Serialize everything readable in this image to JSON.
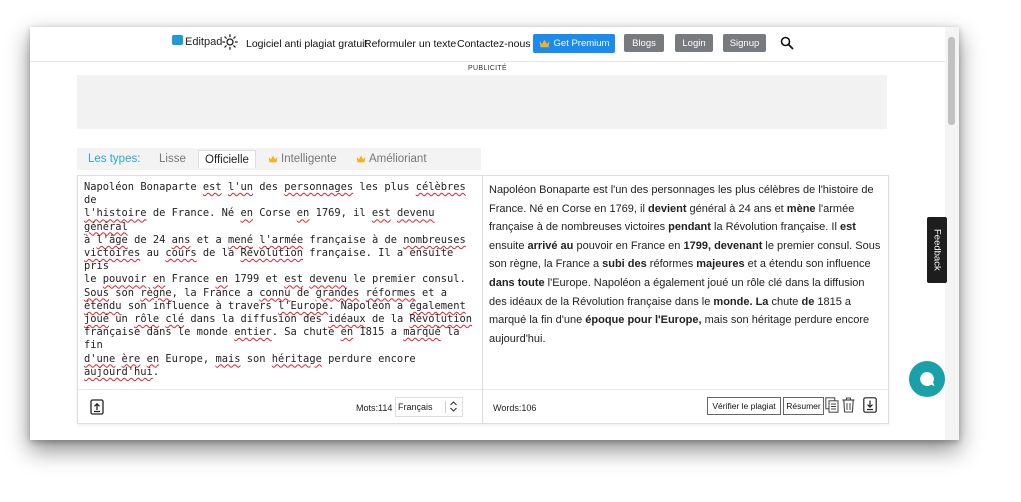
{
  "nav": {
    "brand": "Editpad",
    "links": [
      "Logiciel anti plagiat gratuit",
      "Reformuler un texte",
      "Contactez-nous"
    ],
    "premium_label": "Get Premium",
    "blogs_label": "Blogs",
    "login_label": "Login",
    "signup_label": "Signup"
  },
  "ad": {
    "label": "PUBLICITÉ"
  },
  "types": {
    "label": "Les types:",
    "lisse": "Lisse",
    "officielle": "Officielle",
    "intelligente": "Intelligente",
    "ameliorant": "Amélioriant"
  },
  "left": {
    "lines": [
      "Napoléon Bonaparte est l'un des personnages les plus célèbres de",
      "l'histoire de France. Né en Corse en 1769, il est devenu général",
      "à l'âge de 24 ans et a mené l'armée française à de nombreuses",
      "victoires au cours de la Révolution française. Il a ensuite pris",
      "le pouvoir en France en 1799 et est devenu le premier consul.",
      "Sous son règne, la France a connu de grandes réformes et a",
      "étendu son influence à travers l'Europe. Napoléon a également",
      "joué un rôle clé dans la diffusion des idéaux de la Révolution",
      "française dans le monde entier. Sa chute en 1815 a marqué la fin",
      "d'une ère en Europe, mais son héritage perdure encore",
      "aujourd'hui."
    ],
    "word_count": "Mots:114",
    "language": "Français"
  },
  "right": {
    "segments": [
      {
        "t": "Napoléon Bonaparte est l'un des personnages les plus célèbres de l'histoire de France. Né en Corse en 1769, il ",
        "b": false
      },
      {
        "t": "devient",
        "b": true
      },
      {
        "t": " général à  24 ans et ",
        "b": false
      },
      {
        "t": "mène",
        "b": true
      },
      {
        "t": " l'armée française à de nombreuses victoires ",
        "b": false
      },
      {
        "t": "pendant",
        "b": true
      },
      {
        "t": " la Révolution française. Il ",
        "b": false
      },
      {
        "t": "est",
        "b": true
      },
      {
        "t": " ensuite ",
        "b": false
      },
      {
        "t": "arrivé au",
        "b": true
      },
      {
        "t": " pouvoir en France en ",
        "b": false
      },
      {
        "t": "1799, devenant",
        "b": true
      },
      {
        "t": " le premier consul. Sous son règne, la France a ",
        "b": false
      },
      {
        "t": "subi des",
        "b": true
      },
      {
        "t": " réformes ",
        "b": false
      },
      {
        "t": "majeures",
        "b": true
      },
      {
        "t": " et a étendu son influence ",
        "b": false
      },
      {
        "t": "dans toute",
        "b": true
      },
      {
        "t": " l'Europe. Napoléon a également joué un rôle clé dans la diffusion des idéaux de la Révolution française dans le ",
        "b": false
      },
      {
        "t": "monde. La",
        "b": true
      },
      {
        "t": " chute ",
        "b": false
      },
      {
        "t": "de",
        "b": true
      },
      {
        "t": " 1815 a marqué la fin d'une ",
        "b": false
      },
      {
        "t": "époque pour l'Europe,",
        "b": true
      },
      {
        "t": " mais son héritage perdure encore aujourd'hui.",
        "b": false
      }
    ],
    "word_count": "Words:106",
    "check_plagiarism": "Vérifier le plagiat",
    "summarize": "Résumer"
  },
  "feedback_label": "Feedback",
  "colors": {
    "accent": "#1a8cf0",
    "types_label": "#2aa8d8",
    "chat": "#1aa0a8",
    "crown": "#f3b21c"
  }
}
